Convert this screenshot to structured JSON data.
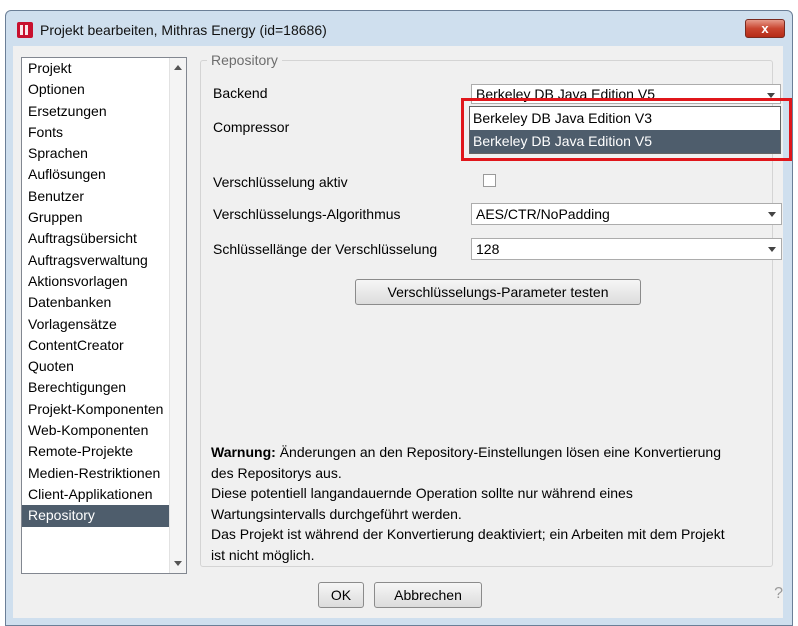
{
  "window": {
    "title": "Projekt bearbeiten, Mithras Energy (id=18686)",
    "close_label": "x"
  },
  "nav": {
    "items": [
      "Projekt",
      "Optionen",
      "Ersetzungen",
      "Fonts",
      "Sprachen",
      "Auflösungen",
      "Benutzer",
      "Gruppen",
      "Auftragsübersicht",
      "Auftragsverwaltung",
      "Aktionsvorlagen",
      "Datenbanken",
      "Vorlagensätze",
      "ContentCreator",
      "Quoten",
      "Berechtigungen",
      "Projekt-Komponenten",
      "Web-Komponenten",
      "Remote-Projekte",
      "Medien-Restriktionen",
      "Client-Applikationen",
      "Repository"
    ],
    "selected": "Repository"
  },
  "repository": {
    "legend": "Repository",
    "backend_label": "Backend",
    "backend_value": "Berkeley DB Java Edition V5",
    "compressor_label": "Compressor",
    "dropdown_options": [
      "Berkeley DB Java Edition V3",
      "Berkeley DB Java Edition V5"
    ],
    "dropdown_highlighted": "Berkeley DB Java Edition V5",
    "encryption_active_label": "Verschlüsselung aktiv",
    "encryption_active_checked": false,
    "algorithm_label": "Verschlüsselungs-Algorithmus",
    "algorithm_value": "AES/CTR/NoPadding",
    "keylength_label": "Schlüssellänge der Verschlüsselung",
    "keylength_value": "128",
    "test_button": "Verschlüsselungs-Parameter testen"
  },
  "warning": {
    "bold": "Warnung:",
    "line1": " Änderungen an den Repository-Einstellungen lösen eine Konvertierung",
    "line2": "des Repositorys aus.",
    "line3": "Diese potentiell langandauernde Operation sollte nur während eines",
    "line4": "Wartungsintervalls durchgeführt werden.",
    "line5": "Das Projekt ist während der Konvertierung deaktiviert; ein Arbeiten mit dem Projekt",
    "line6": "ist nicht möglich."
  },
  "buttons": {
    "ok": "OK",
    "cancel": "Abbrechen",
    "help": "?"
  },
  "colors": {
    "selection": "#4e5d6c",
    "highlight_frame": "#e0161b",
    "title_bar": "#cfdfee"
  }
}
